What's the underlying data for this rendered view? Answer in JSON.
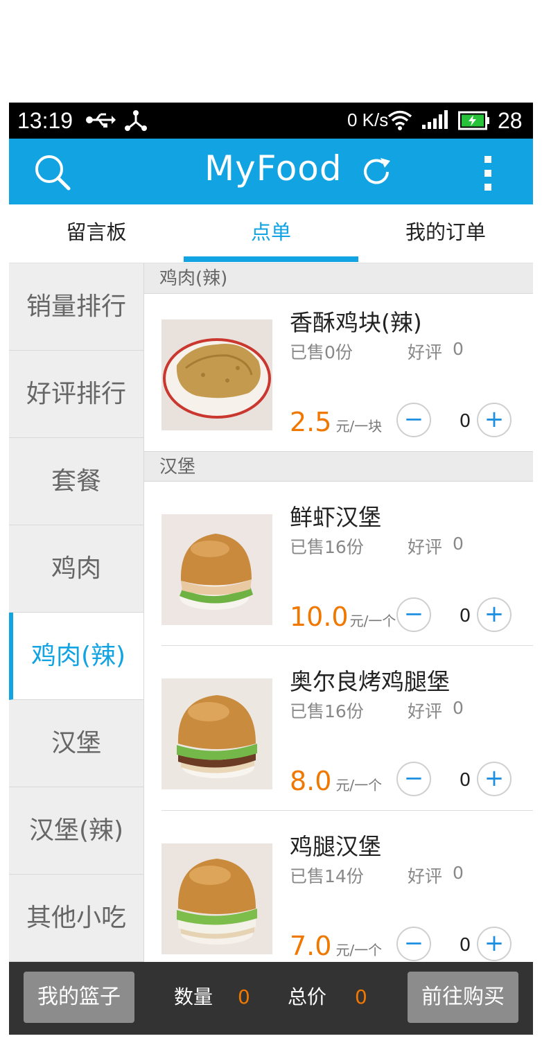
{
  "status_bar": {
    "time": "13:19",
    "net_speed": "0 K/s",
    "battery": "28",
    "icons": [
      "usb-icon",
      "share-icon",
      "wifi-icon",
      "signal-icon",
      "battery-icon"
    ]
  },
  "app_bar": {
    "title": "MyFood",
    "icons": [
      "search-icon",
      "refresh-icon",
      "more-vert-icon"
    ],
    "color": "#12a3e2"
  },
  "tabs": [
    {
      "label": "留言板",
      "active": false
    },
    {
      "label": "点单",
      "active": true
    },
    {
      "label": "我的订单",
      "active": false
    }
  ],
  "categories": [
    {
      "label": "销量排行",
      "active": false
    },
    {
      "label": "好评排行",
      "active": false
    },
    {
      "label": "套餐",
      "active": false
    },
    {
      "label": "鸡肉",
      "active": false
    },
    {
      "label": "鸡肉(辣)",
      "active": true
    },
    {
      "label": "汉堡",
      "active": false
    },
    {
      "label": "汉堡(辣)",
      "active": false
    },
    {
      "label": "其他小吃",
      "active": false
    }
  ],
  "sections": [
    {
      "title": "鸡肉(辣)",
      "items": [
        {
          "name": "香酥鸡块(辣)",
          "sold": "已售0份",
          "rating_label": "好评",
          "rating": "0",
          "price": "2.5",
          "unit": "元/一块",
          "qty": "0",
          "image": "fried-chicken-cutlet"
        }
      ]
    },
    {
      "title": "汉堡",
      "items": [
        {
          "name": "鲜虾汉堡",
          "sold": "已售16份",
          "rating_label": "好评",
          "rating": "0",
          "price": "10.0",
          "unit": "元/一个",
          "qty": "0",
          "image": "shrimp-burger"
        },
        {
          "name": "奥尔良烤鸡腿堡",
          "sold": "已售16份",
          "rating_label": "好评",
          "rating": "0",
          "price": "8.0",
          "unit": "元/一个",
          "qty": "0",
          "image": "orleans-chicken-burger"
        },
        {
          "name": "鸡腿汉堡",
          "sold": "已售14份",
          "rating_label": "好评",
          "rating": "0",
          "price": "7.0",
          "unit": "元/一个",
          "qty": "0",
          "image": "chicken-leg-burger"
        }
      ]
    }
  ],
  "quantity_buttons": {
    "minus": "−",
    "plus": "+"
  },
  "bottom_bar": {
    "basket_label": "我的篮子",
    "count_label": "数量",
    "count": "0",
    "total_label": "总价",
    "total": "0",
    "buy_label": "前往购买"
  },
  "accent_color": "#12a3e2",
  "price_color": "#f07800"
}
